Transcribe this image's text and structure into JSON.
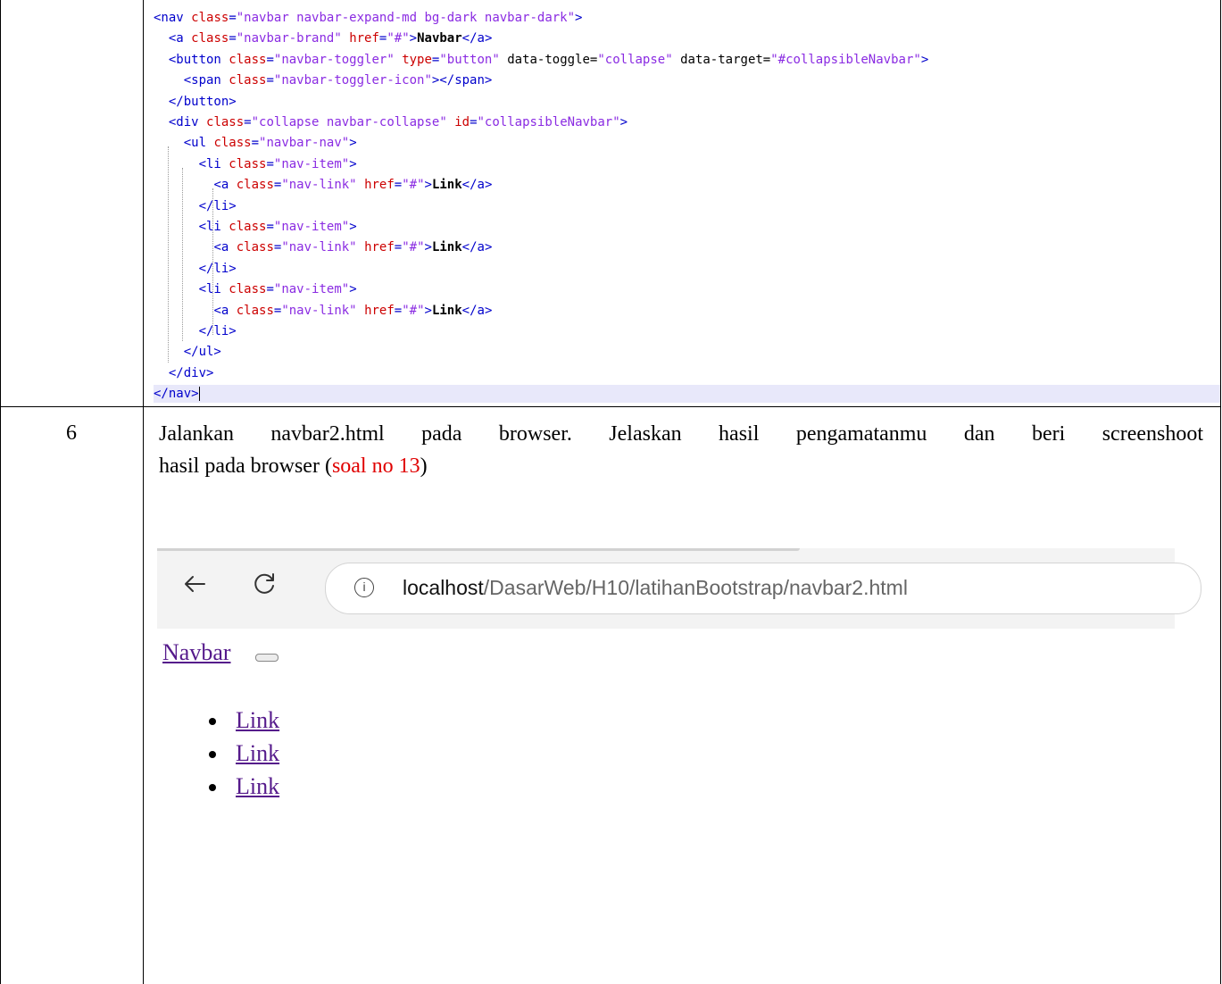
{
  "code": {
    "lines": [
      {
        "tokens": [
          {
            "c": "tg",
            "t": "<nav "
          },
          {
            "c": "an",
            "t": "class"
          },
          {
            "c": "tg",
            "t": "="
          },
          {
            "c": "av",
            "t": "\"navbar navbar-expand-md bg-dark navbar-dark\""
          },
          {
            "c": "tg",
            "t": ">"
          }
        ]
      },
      {
        "tokens": [
          {
            "c": "pl",
            "t": "  "
          },
          {
            "c": "tg",
            "t": "<a "
          },
          {
            "c": "an",
            "t": "class"
          },
          {
            "c": "tg",
            "t": "="
          },
          {
            "c": "av",
            "t": "\"navbar-brand\""
          },
          {
            "c": "pl",
            "t": " "
          },
          {
            "c": "an",
            "t": "href"
          },
          {
            "c": "tg",
            "t": "="
          },
          {
            "c": "av",
            "t": "\"#\""
          },
          {
            "c": "tg",
            "t": ">"
          },
          {
            "c": "tx",
            "t": "Navbar"
          },
          {
            "c": "tg",
            "t": "</a>"
          }
        ]
      },
      {
        "tokens": [
          {
            "c": "pl",
            "t": "  "
          },
          {
            "c": "tg",
            "t": "<button "
          },
          {
            "c": "an",
            "t": "class"
          },
          {
            "c": "tg",
            "t": "="
          },
          {
            "c": "av",
            "t": "\"navbar-toggler\""
          },
          {
            "c": "pl",
            "t": " "
          },
          {
            "c": "an",
            "t": "type"
          },
          {
            "c": "tg",
            "t": "="
          },
          {
            "c": "av",
            "t": "\"button\""
          },
          {
            "c": "pl",
            "t": " data-toggle="
          },
          {
            "c": "av",
            "t": "\"collapse\""
          },
          {
            "c": "pl",
            "t": " data-target="
          },
          {
            "c": "av",
            "t": "\"#collapsibleNavbar\""
          },
          {
            "c": "tg",
            "t": ">"
          }
        ]
      },
      {
        "tokens": [
          {
            "c": "pl",
            "t": "    "
          },
          {
            "c": "tg",
            "t": "<span "
          },
          {
            "c": "an",
            "t": "class"
          },
          {
            "c": "tg",
            "t": "="
          },
          {
            "c": "av",
            "t": "\"navbar-toggler-icon\""
          },
          {
            "c": "tg",
            "t": "></span>"
          }
        ]
      },
      {
        "tokens": [
          {
            "c": "pl",
            "t": "  "
          },
          {
            "c": "tg",
            "t": "</button>"
          }
        ]
      },
      {
        "tokens": [
          {
            "c": "pl",
            "t": "  "
          },
          {
            "c": "tg",
            "t": "<div "
          },
          {
            "c": "an",
            "t": "class"
          },
          {
            "c": "tg",
            "t": "="
          },
          {
            "c": "av",
            "t": "\"collapse navbar-collapse\""
          },
          {
            "c": "pl",
            "t": " "
          },
          {
            "c": "an",
            "t": "id"
          },
          {
            "c": "tg",
            "t": "="
          },
          {
            "c": "av",
            "t": "\"collapsibleNavbar\""
          },
          {
            "c": "tg",
            "t": ">"
          }
        ]
      },
      {
        "tokens": [
          {
            "c": "pl",
            "t": "    "
          },
          {
            "c": "tg",
            "t": "<ul "
          },
          {
            "c": "an",
            "t": "class"
          },
          {
            "c": "tg",
            "t": "="
          },
          {
            "c": "av",
            "t": "\"navbar-nav\""
          },
          {
            "c": "tg",
            "t": ">"
          }
        ]
      },
      {
        "tokens": [
          {
            "c": "pl",
            "t": "      "
          },
          {
            "c": "tg",
            "t": "<li "
          },
          {
            "c": "an",
            "t": "class"
          },
          {
            "c": "tg",
            "t": "="
          },
          {
            "c": "av",
            "t": "\"nav-item\""
          },
          {
            "c": "tg",
            "t": ">"
          }
        ]
      },
      {
        "tokens": [
          {
            "c": "pl",
            "t": "        "
          },
          {
            "c": "tg",
            "t": "<a "
          },
          {
            "c": "an",
            "t": "class"
          },
          {
            "c": "tg",
            "t": "="
          },
          {
            "c": "av",
            "t": "\"nav-link\""
          },
          {
            "c": "pl",
            "t": " "
          },
          {
            "c": "an",
            "t": "href"
          },
          {
            "c": "tg",
            "t": "="
          },
          {
            "c": "av",
            "t": "\"#\""
          },
          {
            "c": "tg",
            "t": ">"
          },
          {
            "c": "tx",
            "t": "Link"
          },
          {
            "c": "tg",
            "t": "</a>"
          }
        ]
      },
      {
        "tokens": [
          {
            "c": "pl",
            "t": "      "
          },
          {
            "c": "tg",
            "t": "</li>"
          }
        ]
      },
      {
        "tokens": [
          {
            "c": "pl",
            "t": "      "
          },
          {
            "c": "tg",
            "t": "<li "
          },
          {
            "c": "an",
            "t": "class"
          },
          {
            "c": "tg",
            "t": "="
          },
          {
            "c": "av",
            "t": "\"nav-item\""
          },
          {
            "c": "tg",
            "t": ">"
          }
        ]
      },
      {
        "tokens": [
          {
            "c": "pl",
            "t": "        "
          },
          {
            "c": "tg",
            "t": "<a "
          },
          {
            "c": "an",
            "t": "class"
          },
          {
            "c": "tg",
            "t": "="
          },
          {
            "c": "av",
            "t": "\"nav-link\""
          },
          {
            "c": "pl",
            "t": " "
          },
          {
            "c": "an",
            "t": "href"
          },
          {
            "c": "tg",
            "t": "="
          },
          {
            "c": "av",
            "t": "\"#\""
          },
          {
            "c": "tg",
            "t": ">"
          },
          {
            "c": "tx",
            "t": "Link"
          },
          {
            "c": "tg",
            "t": "</a>"
          }
        ]
      },
      {
        "tokens": [
          {
            "c": "pl",
            "t": "      "
          },
          {
            "c": "tg",
            "t": "</li>"
          }
        ]
      },
      {
        "tokens": [
          {
            "c": "pl",
            "t": "      "
          },
          {
            "c": "tg",
            "t": "<li "
          },
          {
            "c": "an",
            "t": "class"
          },
          {
            "c": "tg",
            "t": "="
          },
          {
            "c": "av",
            "t": "\"nav-item\""
          },
          {
            "c": "tg",
            "t": ">"
          }
        ]
      },
      {
        "tokens": [
          {
            "c": "pl",
            "t": "        "
          },
          {
            "c": "tg",
            "t": "<a "
          },
          {
            "c": "an",
            "t": "class"
          },
          {
            "c": "tg",
            "t": "="
          },
          {
            "c": "av",
            "t": "\"nav-link\""
          },
          {
            "c": "pl",
            "t": " "
          },
          {
            "c": "an",
            "t": "href"
          },
          {
            "c": "tg",
            "t": "="
          },
          {
            "c": "av",
            "t": "\"#\""
          },
          {
            "c": "tg",
            "t": ">"
          },
          {
            "c": "tx",
            "t": "Link"
          },
          {
            "c": "tg",
            "t": "</a>"
          }
        ]
      },
      {
        "tokens": [
          {
            "c": "pl",
            "t": "      "
          },
          {
            "c": "tg",
            "t": "</li>"
          }
        ]
      },
      {
        "tokens": [
          {
            "c": "pl",
            "t": "    "
          },
          {
            "c": "tg",
            "t": "</ul>"
          }
        ]
      },
      {
        "tokens": [
          {
            "c": "pl",
            "t": "  "
          },
          {
            "c": "tg",
            "t": "</div>"
          }
        ]
      },
      {
        "tokens": [
          {
            "c": "tg",
            "t": "</nav>"
          }
        ],
        "highlighted": true
      }
    ]
  },
  "row": {
    "number": "6",
    "instruction_line1": "Jalankan navbar2.html pada browser. Jelaskan hasil pengamatanmu dan beri screenshoot",
    "instruction_prefix": "hasil pada browser (",
    "instruction_ref": "soal no 13",
    "instruction_suffix": ")"
  },
  "browser": {
    "back_icon": "back-arrow-icon",
    "reload_icon": "reload-icon",
    "info_icon": "info-icon",
    "info_glyph": "i",
    "url_host": "localhost",
    "url_path": "/DasarWeb/H10/latihanBootstrap/navbar2.html"
  },
  "page": {
    "brand": "Navbar",
    "links": [
      "Link",
      "Link",
      "Link"
    ]
  },
  "colors": {
    "tag": "#0000cc",
    "attr_name": "#cc0000",
    "attr_value": "#8a2be2",
    "highlight_line": "#e8e8fa",
    "reference_red": "#e00000",
    "visited_link": "#551a8b"
  }
}
